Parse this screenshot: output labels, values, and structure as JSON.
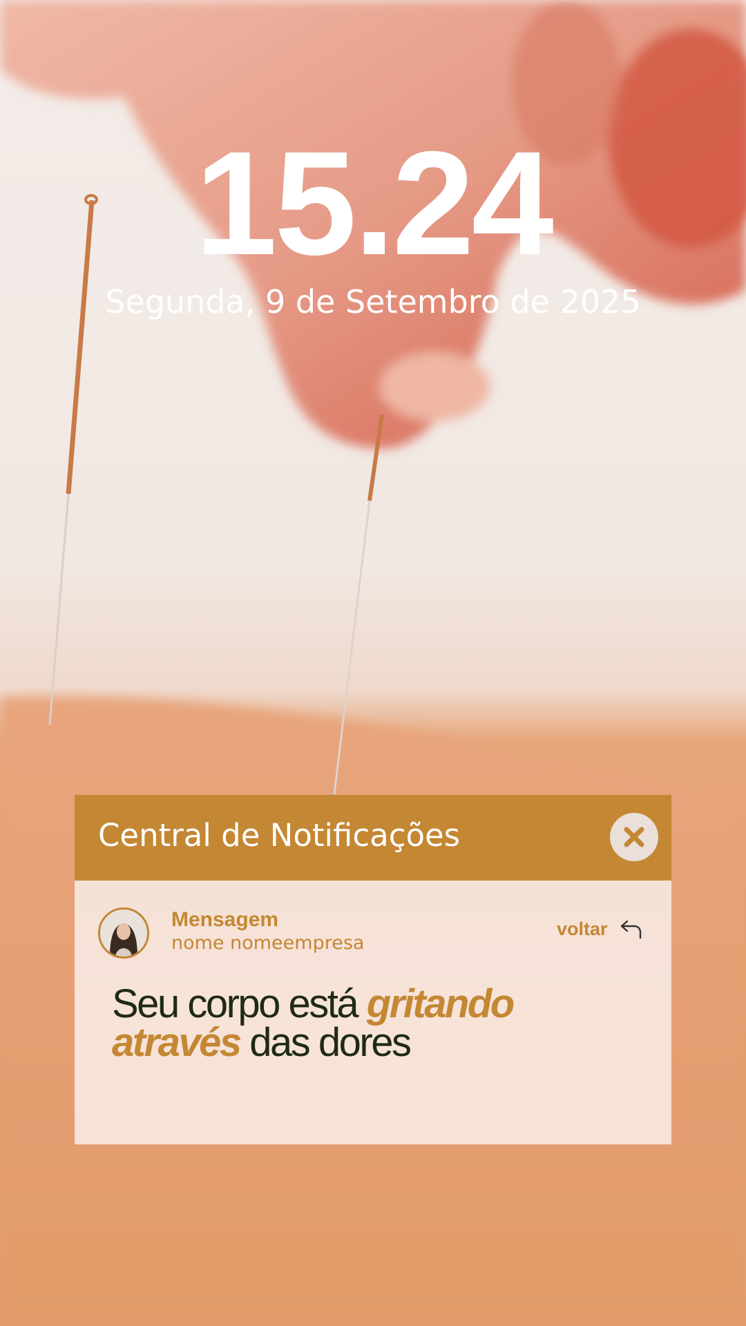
{
  "lockscreen": {
    "time": "15.24",
    "date": "Segunda, 9 de Setembro de 2025"
  },
  "notification_center": {
    "title": "Central de Notificações",
    "close_icon": "close-x-icon",
    "accent_color": "#c48733",
    "notification": {
      "type_label": "Mensagem",
      "sender": "nome nomeempresa",
      "back_label": "voltar",
      "back_icon": "reply-arrow-icon",
      "message_parts": [
        {
          "text": "Seu corpo está ",
          "emphasis": false
        },
        {
          "text": "gritando",
          "emphasis": true
        },
        {
          "text": " ",
          "emphasis": false
        },
        {
          "text": "através",
          "emphasis": true
        },
        {
          "text": " das dores",
          "emphasis": false
        }
      ]
    }
  }
}
